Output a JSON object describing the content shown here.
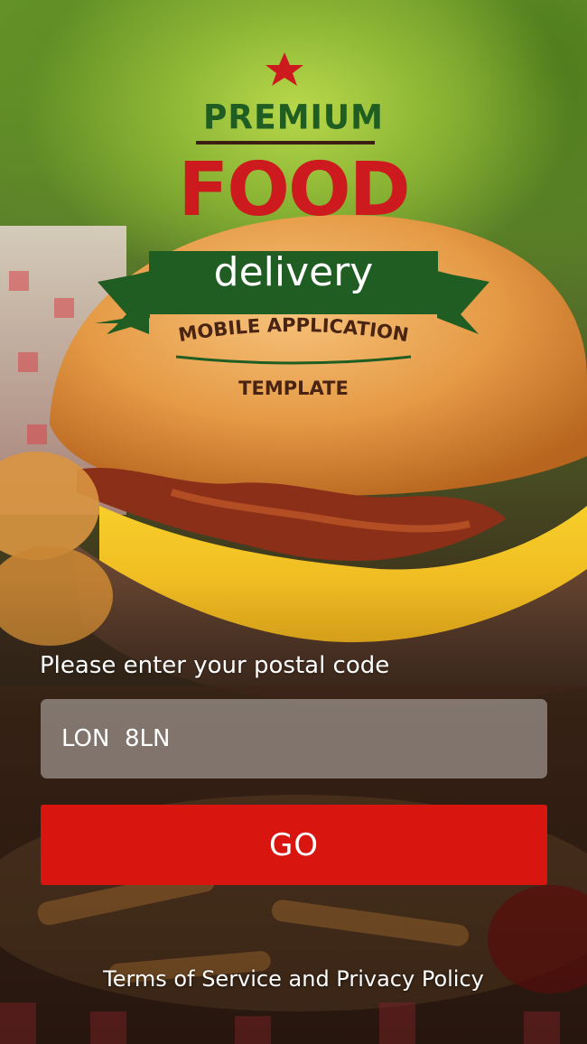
{
  "logo": {
    "premium": "PREMIUM",
    "food": "FOOD",
    "delivery": "delivery",
    "subtitle_line1": "MOBILE APPLICATION",
    "subtitle_line2": "TEMPLATE",
    "star_icon": "star-icon",
    "colors": {
      "green": "#1f5d22",
      "red": "#cc1a1f",
      "brown": "#4a2412"
    }
  },
  "form": {
    "postal_label": "Please enter your postal code",
    "postal_value": "LON  8LN",
    "go_label": "GO",
    "go_color": "#d8160f"
  },
  "footer": {
    "terms_link": "Terms of Service and Privacy Policy"
  }
}
